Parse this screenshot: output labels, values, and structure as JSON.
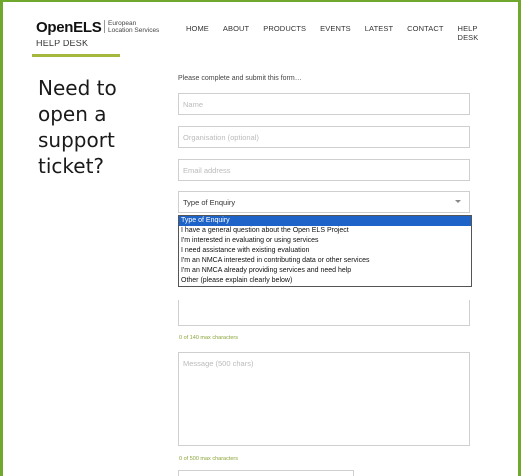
{
  "brand": {
    "logo": "OpenELS",
    "sub_line1": "European",
    "sub_line2": "Location Services",
    "accent_color": "#6fa82d"
  },
  "nav": {
    "items": [
      {
        "label": "HOME"
      },
      {
        "label": "ABOUT"
      },
      {
        "label": "PRODUCTS"
      },
      {
        "label": "EVENTS"
      },
      {
        "label": "LATEST"
      },
      {
        "label": "CONTACT"
      },
      {
        "label": "HELP DESK"
      }
    ]
  },
  "breadcrumb": "HELP DESK",
  "heading": "Need to open a support ticket?",
  "form": {
    "intro": "Please complete and submit this form…",
    "name_placeholder": "Name",
    "organisation_placeholder": "Organisation (optional)",
    "email_placeholder": "Email address",
    "enquiry_selected": "Type of Enquiry",
    "enquiry_options": [
      "Type of Enquiry",
      "I have a general question about the Open ELS Project",
      "I'm interested in evaluating or using services",
      "I need assistance with existing evaluation",
      "I'm an NMCA interested in contributing data or other services",
      "I'm an NMCA already providing services and need help",
      "Other (please explain clearly below)"
    ],
    "subject_count": "0 of 140 max characters",
    "message_placeholder": "Message (500 chars)",
    "message_count": "0 of 500 max characters"
  }
}
